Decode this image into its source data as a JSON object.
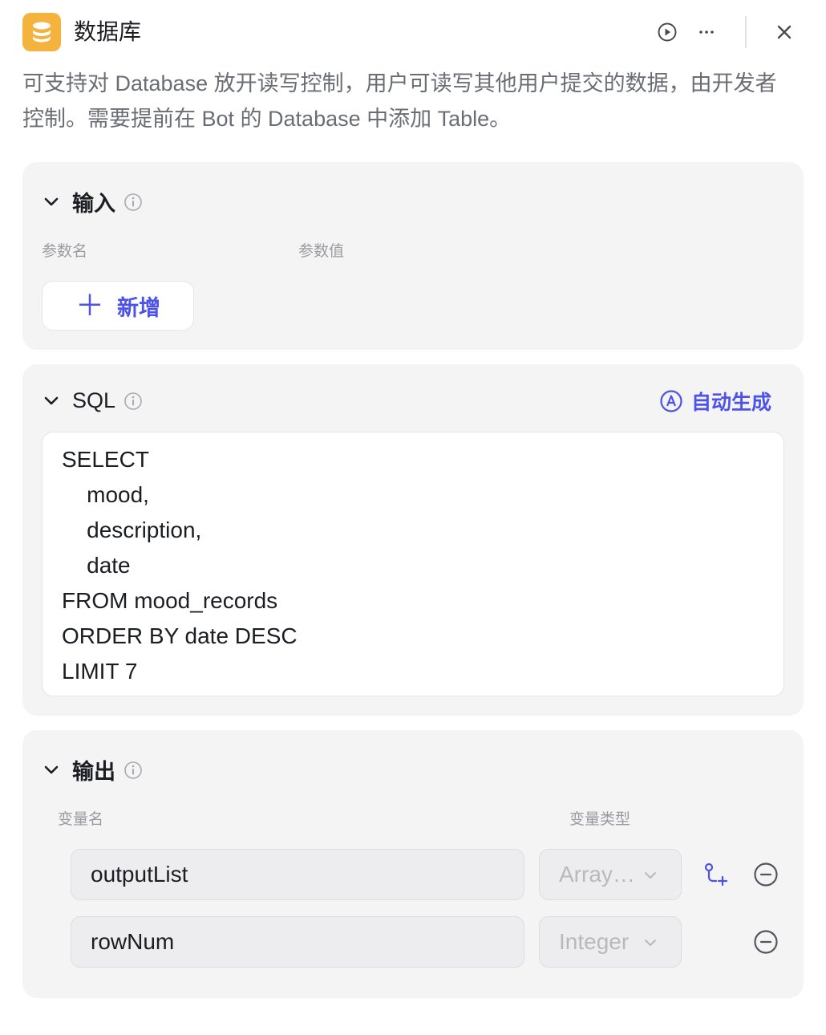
{
  "header": {
    "title": "数据库",
    "app_icon": "database-icon",
    "actions": [
      "play-circle-icon",
      "more-icon",
      "close-icon"
    ]
  },
  "description": "可支持对 Database 放开读写控制，用户可读写其他用户提交的数据，由开发者控制。需要提前在 Bot 的 Database 中添加 Table。",
  "input": {
    "title": "输入",
    "col_name": "参数名",
    "col_value": "参数值",
    "add_label": "新增"
  },
  "sql": {
    "title": "SQL",
    "auto_label": "自动生成",
    "lines": [
      "SELECT",
      "    mood,",
      "    description,",
      "    date",
      "FROM mood_records",
      "ORDER BY date DESC",
      "LIMIT 7"
    ]
  },
  "output": {
    "title": "输出",
    "col_name": "变量名",
    "col_type": "变量类型",
    "rows": [
      {
        "name": "outputList",
        "type": "Array…"
      },
      {
        "name": "rowNum",
        "type": "Integer"
      }
    ]
  },
  "colors": {
    "accent": "#4d53e8",
    "app_icon_bg": "#f5b23c",
    "panel_bg": "#f4f4f5"
  }
}
